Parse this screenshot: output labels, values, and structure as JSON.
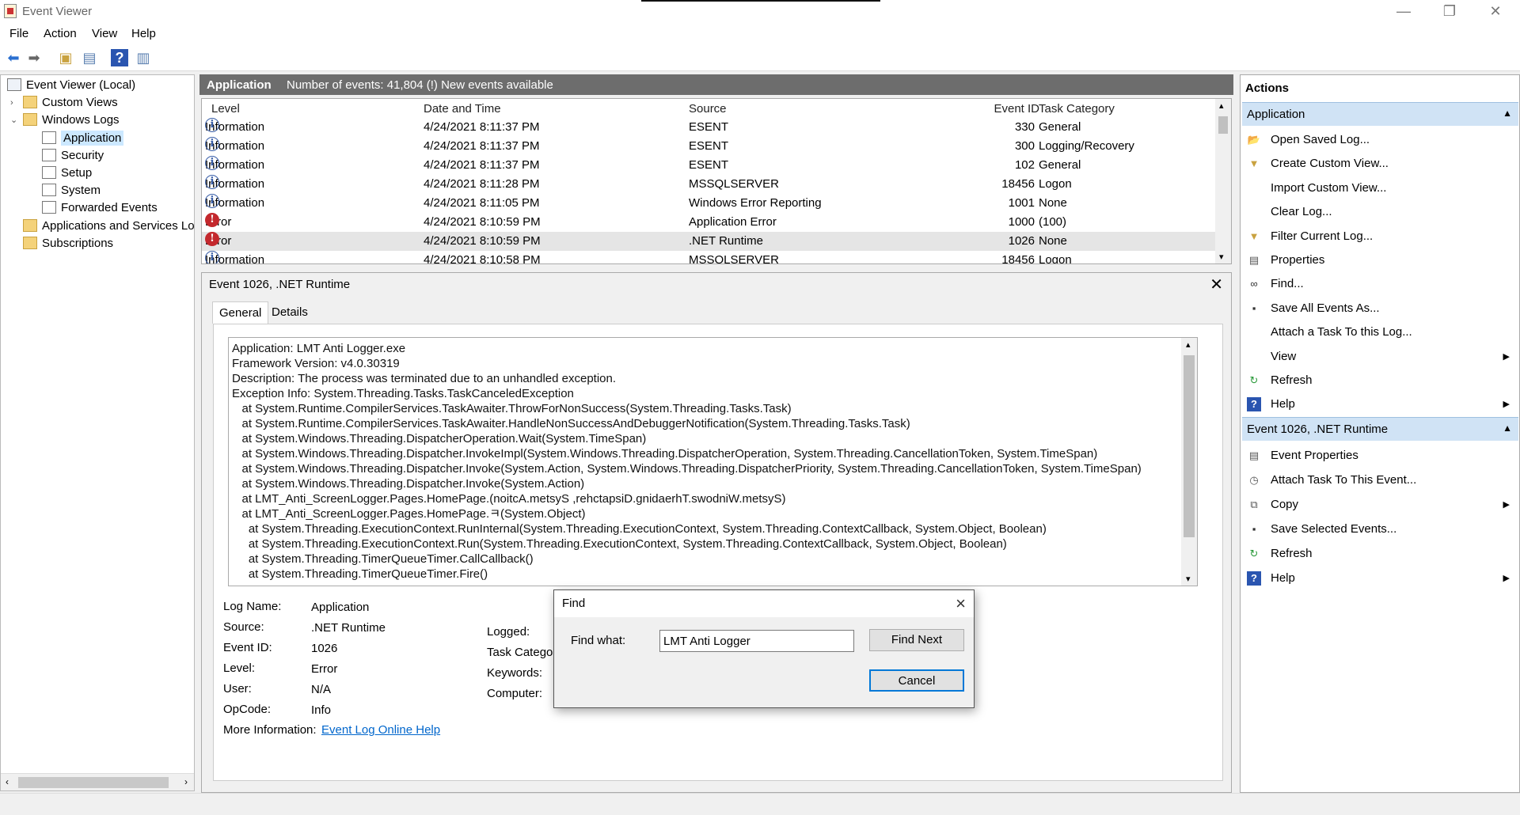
{
  "window": {
    "title": "Event Viewer",
    "minimize": "—",
    "restore": "❐",
    "close": "✕"
  },
  "menu": [
    "File",
    "Action",
    "View",
    "Help"
  ],
  "tree": {
    "root": "Event Viewer (Local)",
    "custom_views": "Custom Views",
    "windows_logs": "Windows Logs",
    "application": "Application",
    "security": "Security",
    "setup": "Setup",
    "system": "System",
    "forwarded": "Forwarded Events",
    "apps_services": "Applications and Services Log",
    "subscriptions": "Subscriptions"
  },
  "log": {
    "name": "Application",
    "summary": "Number of events: 41,804 (!) New events available"
  },
  "columns": {
    "level": "Level",
    "datetime": "Date and Time",
    "source": "Source",
    "event_id": "Event ID",
    "task": "Task Category"
  },
  "events": [
    {
      "level": "Information",
      "datetime": "4/24/2021 8:11:37 PM",
      "source": "ESENT",
      "event_id": "330",
      "task": "General",
      "icon": "info-icon"
    },
    {
      "level": "Information",
      "datetime": "4/24/2021 8:11:37 PM",
      "source": "ESENT",
      "event_id": "300",
      "task": "Logging/Recovery",
      "icon": "info-icon"
    },
    {
      "level": "Information",
      "datetime": "4/24/2021 8:11:37 PM",
      "source": "ESENT",
      "event_id": "102",
      "task": "General",
      "icon": "info-icon"
    },
    {
      "level": "Information",
      "datetime": "4/24/2021 8:11:28 PM",
      "source": "MSSQLSERVER",
      "event_id": "18456",
      "task": "Logon",
      "icon": "info-icon"
    },
    {
      "level": "Information",
      "datetime": "4/24/2021 8:11:05 PM",
      "source": "Windows Error Reporting",
      "event_id": "1001",
      "task": "None",
      "icon": "info-icon"
    },
    {
      "level": "Error",
      "datetime": "4/24/2021 8:10:59 PM",
      "source": "Application Error",
      "event_id": "1000",
      "task": "(100)",
      "icon": "error-icon"
    },
    {
      "level": "Error",
      "datetime": "4/24/2021 8:10:59 PM",
      "source": ".NET Runtime",
      "event_id": "1026",
      "task": "None",
      "icon": "error-icon"
    },
    {
      "level": "Information",
      "datetime": "4/24/2021 8:10:58 PM",
      "source": "MSSQLSERVER",
      "event_id": "18456",
      "task": "Logon",
      "icon": "info-icon"
    }
  ],
  "detail": {
    "title": "Event 1026, .NET Runtime",
    "tab_general": "General",
    "tab_details": "Details",
    "description": "Application: LMT Anti Logger.exe\nFramework Version: v4.0.30319\nDescription: The process was terminated due to an unhandled exception.\nException Info: System.Threading.Tasks.TaskCanceledException\n   at System.Runtime.CompilerServices.TaskAwaiter.ThrowForNonSuccess(System.Threading.Tasks.Task)\n   at System.Runtime.CompilerServices.TaskAwaiter.HandleNonSuccessAndDebuggerNotification(System.Threading.Tasks.Task)\n   at System.Windows.Threading.DispatcherOperation.Wait(System.TimeSpan)\n   at System.Windows.Threading.Dispatcher.InvokeImpl(System.Windows.Threading.DispatcherOperation, System.Threading.CancellationToken, System.TimeSpan)\n   at System.Windows.Threading.Dispatcher.Invoke(System.Action, System.Windows.Threading.DispatcherPriority, System.Threading.CancellationToken, System.TimeSpan)\n   at System.Windows.Threading.Dispatcher.Invoke(System.Action)\n   at LMT_Anti_ScreenLogger.Pages.HomePage.(noitcA.metsyS ,rehctapsiD.gnidaerhT.swodniW.metsyS)\n   at LMT_Anti_ScreenLogger.Pages.HomePage.ㅋ(System.Object)\n     at System.Threading.ExecutionContext.RunInternal(System.Threading.ExecutionContext, System.Threading.ContextCallback, System.Object, Boolean)\n     at System.Threading.ExecutionContext.Run(System.Threading.ExecutionContext, System.Threading.ContextCallback, System.Object, Boolean)\n     at System.Threading.TimerQueueTimer.CallCallback()\n     at System.Threading.TimerQueueTimer.Fire()",
    "labels": {
      "log_name": "Log Name:",
      "source": "Source:",
      "event_id": "Event ID:",
      "level": "Level:",
      "user": "User:",
      "opcode": "OpCode:",
      "more_info": "More Information:",
      "logged": "Logged:",
      "task_category": "Task Categor",
      "keywords": "Keywords:",
      "computer": "Computer:"
    },
    "values": {
      "log_name": "Application",
      "source": ".NET Runtime",
      "event_id": "1026",
      "level": "Error",
      "user": "N/A",
      "opcode": "Info",
      "more_info_link": "Event Log Online Help"
    }
  },
  "actions": {
    "title": "Actions",
    "section1": "Application",
    "section1_items": [
      {
        "label": "Open Saved Log...",
        "icon": "folder-open-icon"
      },
      {
        "label": "Create Custom View...",
        "icon": "filter-icon"
      },
      {
        "label": "Import Custom View...",
        "icon": ""
      },
      {
        "label": "Clear Log...",
        "icon": ""
      },
      {
        "label": "Filter Current Log...",
        "icon": "filter-icon"
      },
      {
        "label": "Properties",
        "icon": "properties-icon"
      },
      {
        "label": "Find...",
        "icon": "binoculars-icon"
      },
      {
        "label": "Save All Events As...",
        "icon": "save-icon"
      },
      {
        "label": "Attach a Task To this Log...",
        "icon": ""
      },
      {
        "label": "View",
        "icon": "",
        "submenu": true
      },
      {
        "label": "Refresh",
        "icon": "refresh-icon"
      },
      {
        "label": "Help",
        "icon": "help-icon",
        "submenu": true
      }
    ],
    "section2": "Event 1026, .NET Runtime",
    "section2_items": [
      {
        "label": "Event Properties",
        "icon": "properties-icon"
      },
      {
        "label": "Attach Task To This Event...",
        "icon": "task-icon"
      },
      {
        "label": "Copy",
        "icon": "copy-icon",
        "submenu": true
      },
      {
        "label": "Save Selected Events...",
        "icon": "save-icon"
      },
      {
        "label": "Refresh",
        "icon": "refresh-icon"
      },
      {
        "label": "Help",
        "icon": "help-icon",
        "submenu": true
      }
    ]
  },
  "find_dialog": {
    "title": "Find",
    "label": "Find what:",
    "value": "LMT Anti Logger",
    "find_next": "Find Next",
    "cancel": "Cancel"
  }
}
